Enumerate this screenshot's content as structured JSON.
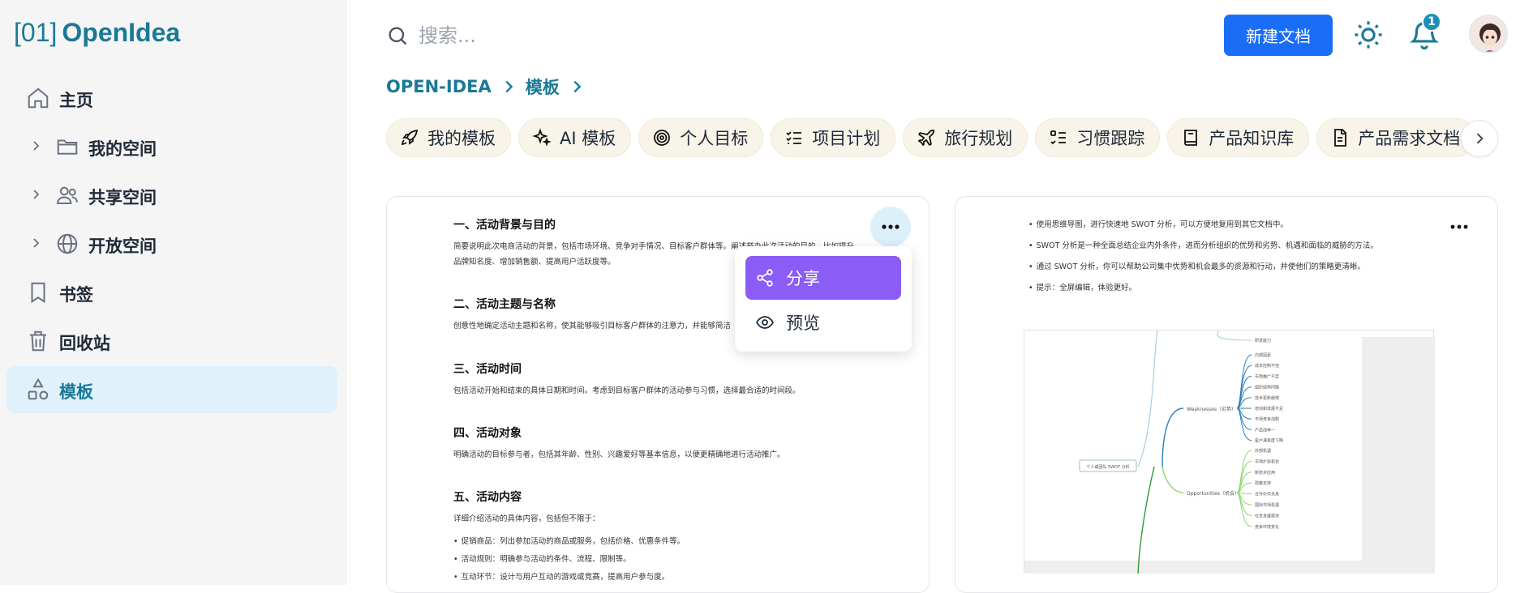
{
  "app": {
    "logo_prefix": "[01]",
    "logo_name": "OpenIdea"
  },
  "sidebar": {
    "items": [
      {
        "label": "主页",
        "icon": "home-icon"
      },
      {
        "label": "我的空间",
        "icon": "folder-icon"
      },
      {
        "label": "共享空间",
        "icon": "users-icon"
      },
      {
        "label": "开放空间",
        "icon": "globe-icon"
      },
      {
        "label": "书签",
        "icon": "bookmark-icon"
      },
      {
        "label": "回收站",
        "icon": "trash-icon"
      },
      {
        "label": "模板",
        "icon": "shapes-icon",
        "active": true
      }
    ]
  },
  "header": {
    "search_placeholder": "搜索...",
    "new_doc_label": "新建文档",
    "notification_count": "1"
  },
  "breadcrumb": [
    "OPEN-IDEA",
    "模板"
  ],
  "tags": [
    {
      "label": "我的模板",
      "icon": "rocket-icon"
    },
    {
      "label": "AI 模板",
      "icon": "sparkles-icon"
    },
    {
      "label": "个人目标",
      "icon": "target-icon"
    },
    {
      "label": "项目计划",
      "icon": "list-checks-icon"
    },
    {
      "label": "旅行规划",
      "icon": "plane-icon"
    },
    {
      "label": "习惯跟踪",
      "icon": "list-todo-icon"
    },
    {
      "label": "产品知识库",
      "icon": "book-icon"
    },
    {
      "label": "产品需求文档",
      "icon": "file-text-icon"
    }
  ],
  "card1": {
    "sections": [
      {
        "title": "一、活动背景与目的",
        "lines": [
          "简要说明此次电商活动的背景，包括市场环境、竞争对手情况、目标客户群体等。阐述举办此次活动的目的，比如提升",
          "品牌知名度、增加销售额、提高用户活跃度等。"
        ]
      },
      {
        "title": "二、活动主题与名称",
        "lines": [
          "创意性地确定活动主题和名称，使其能够吸引目标客户群体的注意力，并能够简洁"
        ]
      },
      {
        "title": "三、活动时间",
        "lines": [
          "包括活动开始和结束的具体日期和时间。考虑到目标客户群体的活动参与习惯，选择最合适的时间段。"
        ]
      },
      {
        "title": "四、活动对象",
        "lines": [
          "明确活动的目标参与者，包括其年龄、性别、兴趣爱好等基本信息，以便更精确地进行活动推广。"
        ]
      },
      {
        "title": "五、活动内容",
        "lines": [
          "详细介绍活动的具体内容，包括但不限于："
        ]
      }
    ],
    "bullets": [
      "促销商品：列出参加活动的商品或服务，包括价格、优惠条件等。",
      "活动规则：明确参与活动的条件、流程、限制等。",
      "互动环节：设计与用户互动的游戏或竞赛，提高用户参与度。"
    ]
  },
  "menu": {
    "share_label": "分享",
    "preview_label": "预览"
  },
  "card2": {
    "bullets": [
      "使用思维导图，进行快速地 SWOT 分析，可以方便地复用到其它文档中。",
      "SWOT 分析是一种全面总结企业内外条件，进而分析组织的优势和劣势、机遇和面临的威胁的方法。",
      "通过 SWOT 分析，你可以帮助公司集中优势和机会最多的资源和行动，并使他们的策略更清晰。",
      "提示：全屏编辑，体验更好。"
    ],
    "mindmap": {
      "root": "个人或团队 SWOT 分析",
      "weakness_label": "Weaknesses（劣势）",
      "opportunity_label": "Opportunities（机会）",
      "top_leaves": [
        "研发能力"
      ],
      "weakness_leaves": [
        "内部因素",
        "成本控制不佳",
        "市场推广不足",
        "组织结构问题",
        "技术更新缓慢",
        "培训和发展不足",
        "市场竞争加剧",
        "产品线单一",
        "客户满意度下降"
      ],
      "opportunity_leaves": [
        "外部机遇",
        "市场扩张机会",
        "新技术应用",
        "政策支持",
        "合作伙伴关系",
        "国际市场机遇",
        "社会发展需求",
        "竞争环境变化"
      ]
    }
  }
}
